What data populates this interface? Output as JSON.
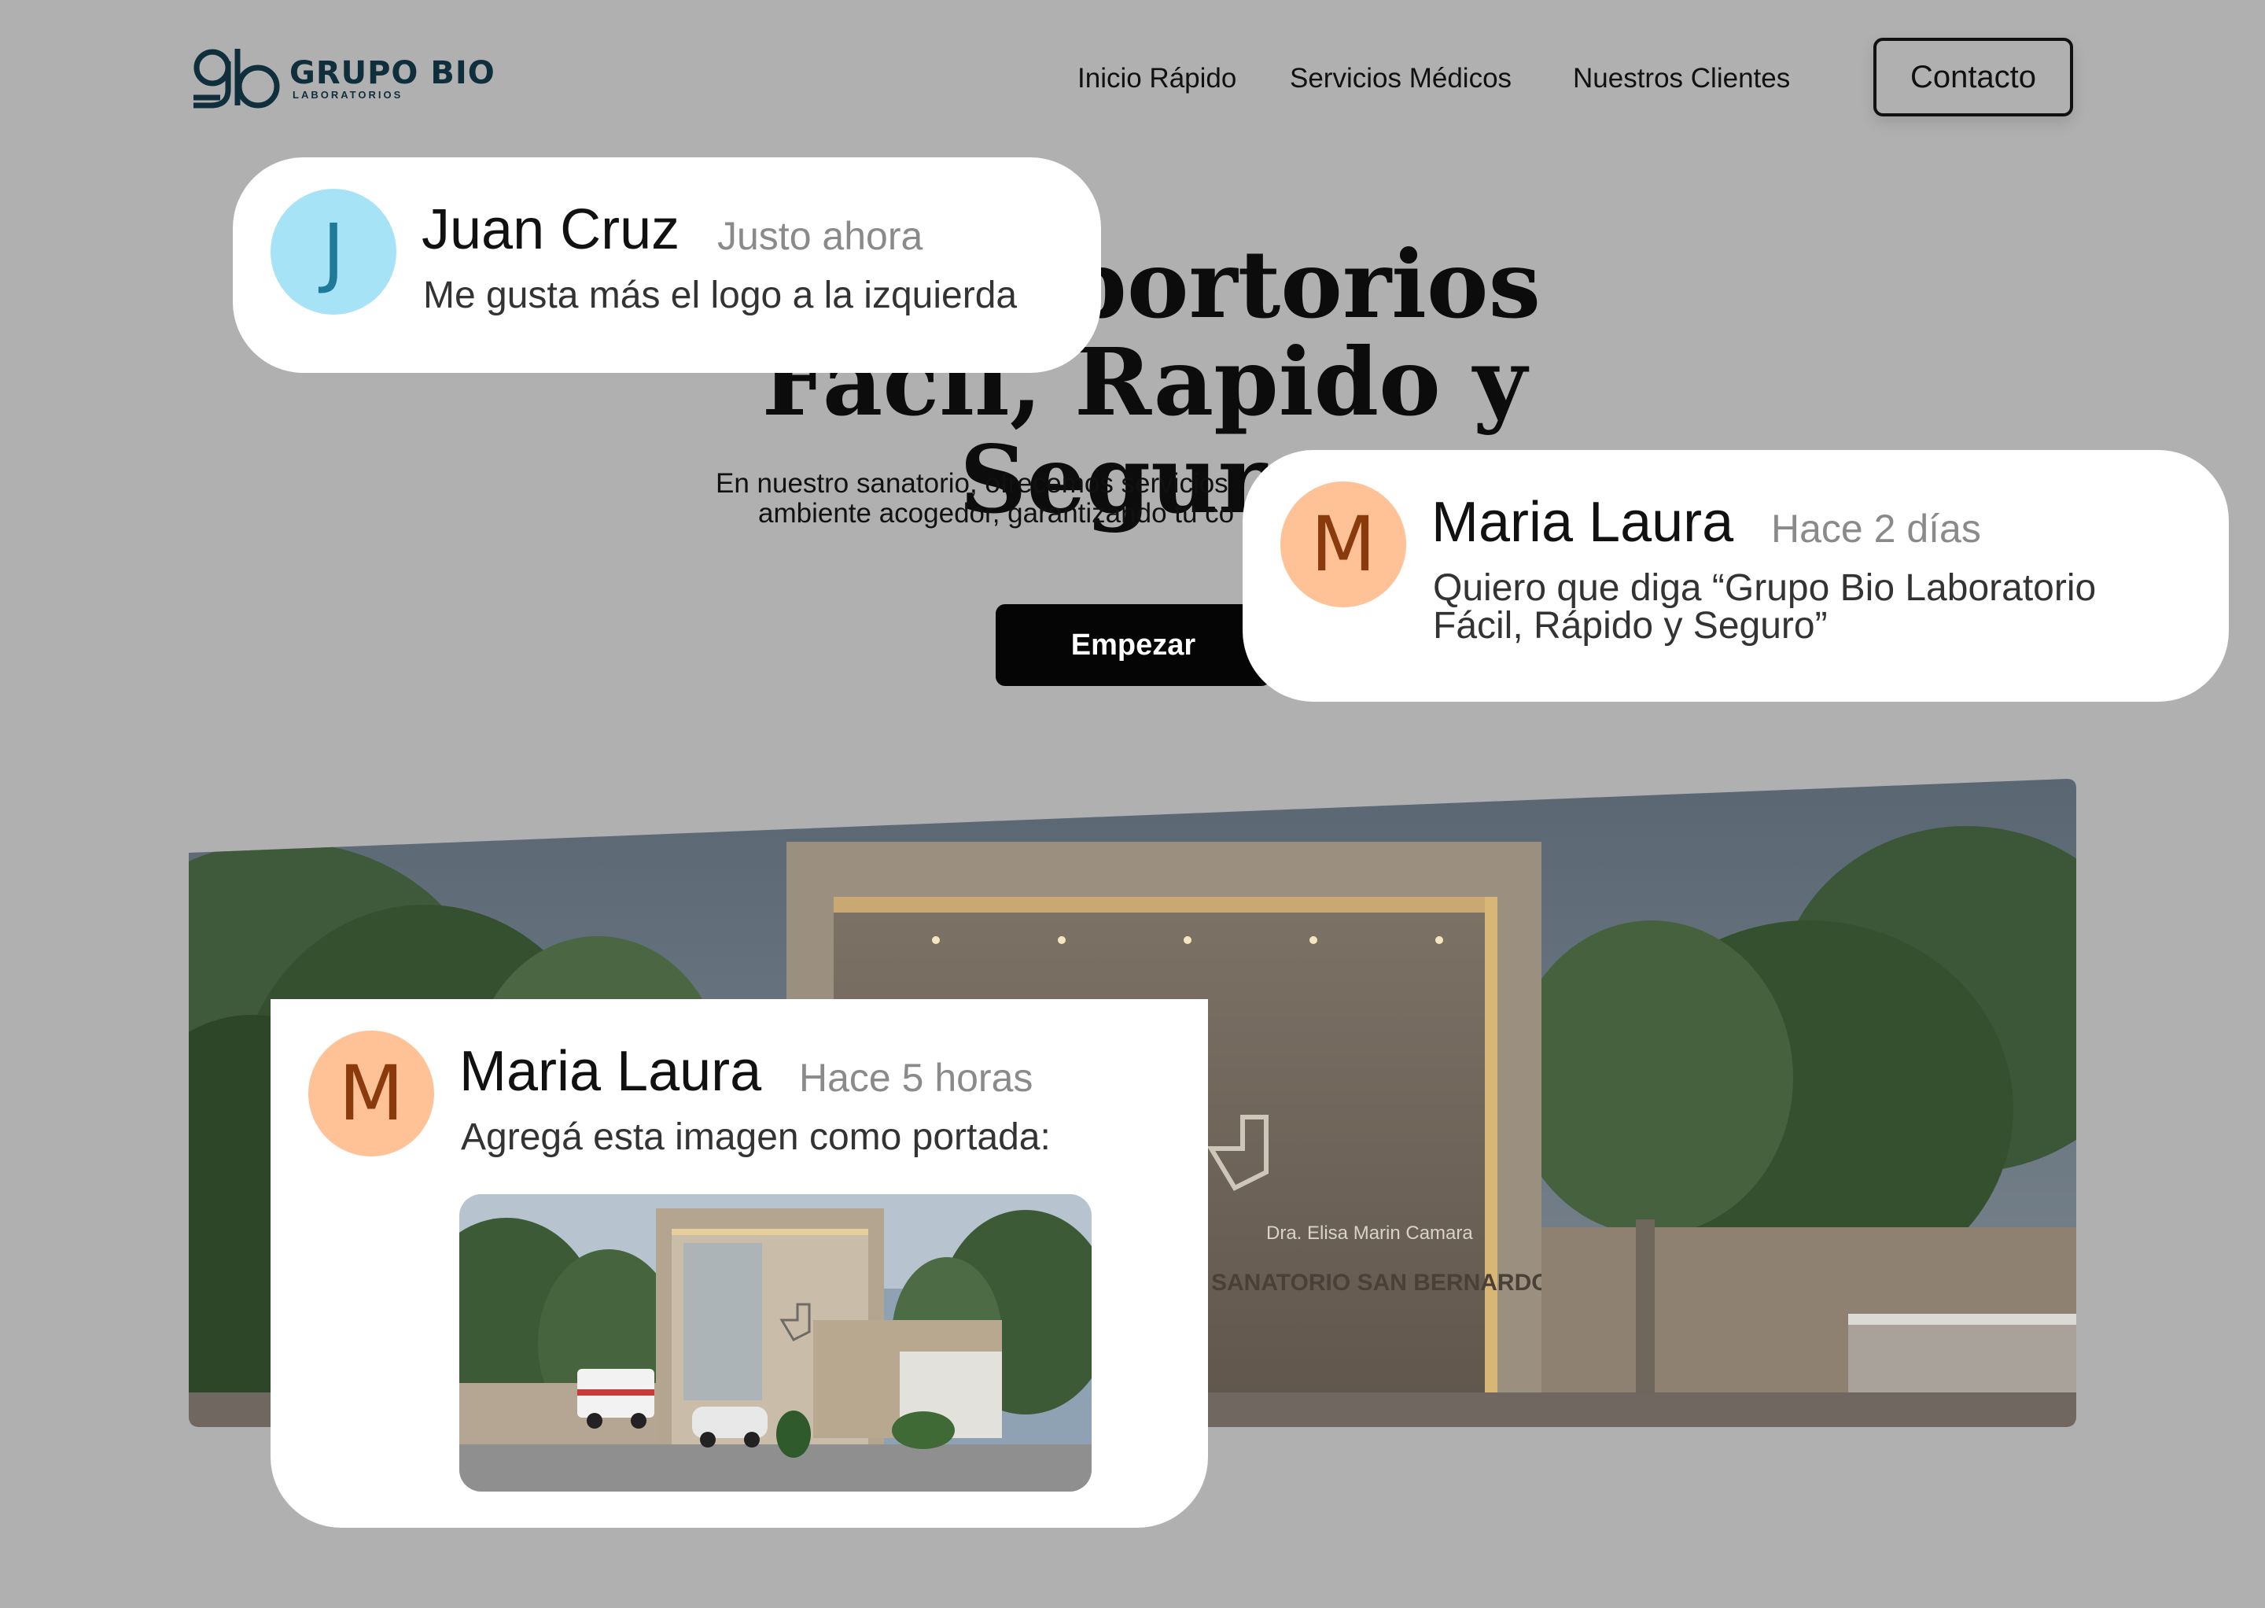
{
  "header": {
    "logo": {
      "mark": "gb",
      "name": "GRUPO BIO",
      "sub": "LABORATORIOS"
    },
    "nav": [
      "Inicio Rápido",
      "Servicios Médicos",
      "Nuestros Clientes"
    ],
    "contact_label": "Contacto"
  },
  "hero": {
    "title_line1": "Labortorios",
    "title_line2": "Facil, Rapido y Seguro",
    "subtitle_line1": "En nuestro sanatorio, ofrecemos servicios",
    "subtitle_line2": "ambiente acogedor, garantizando tu co",
    "cta_label": "Empezar"
  },
  "banner": {
    "sign_line1": "Dra. Elisa Marin Camara",
    "sign_line2": "SANATORIO SAN BERNARDO"
  },
  "comments": [
    {
      "initial": "J",
      "author": "Juan Cruz",
      "time": "Justo ahora",
      "text": "Me gusta más el logo a la izquierda",
      "avatar_bg": "#a7e3f7",
      "avatar_fg": "#1f7a99"
    },
    {
      "initial": "M",
      "author": "Maria Laura",
      "time": "Hace 2 días",
      "text_line1": "Quiero que diga “Grupo Bio Laboratorio",
      "text_line2": "Fácil, Rápido y Seguro”",
      "avatar_bg": "#ffc196",
      "avatar_fg": "#8a3b0d"
    },
    {
      "initial": "M",
      "author": "Maria Laura",
      "time": "Hace 5 horas",
      "text": "Agregá esta imagen como portada:",
      "avatar_bg": "#ffc196",
      "avatar_fg": "#8a3b0d"
    }
  ],
  "colors": {
    "page_bg": "#b0b0b0",
    "dark": "#050505",
    "logo": "#0f2f3d"
  }
}
